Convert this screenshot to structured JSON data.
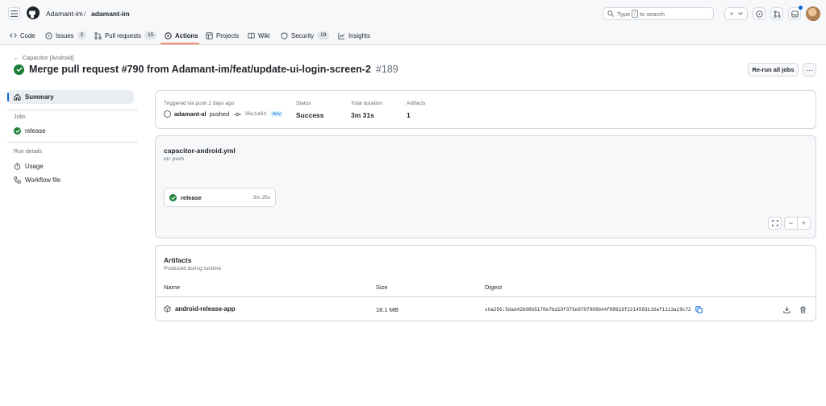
{
  "header": {
    "owner": "Adamant-im",
    "separator": "/",
    "repo": "adamant-im",
    "search_prefix": "Type",
    "search_key": "/",
    "search_suffix": "to search",
    "new_label": "+"
  },
  "nav": {
    "tabs": [
      {
        "label": "Code",
        "icon": "code-icon"
      },
      {
        "label": "Issues",
        "count": "2",
        "icon": "issue-icon"
      },
      {
        "label": "Pull requests",
        "count": "15",
        "icon": "pull-request-icon"
      },
      {
        "label": "Actions",
        "icon": "play-icon",
        "active": true
      },
      {
        "label": "Projects",
        "icon": "table-icon"
      },
      {
        "label": "Wiki",
        "icon": "book-icon"
      },
      {
        "label": "Security",
        "count": "19",
        "icon": "shield-icon"
      },
      {
        "label": "Insights",
        "icon": "graph-icon"
      }
    ]
  },
  "run": {
    "back_label": "Capacitor [Android]",
    "title": "Merge pull request #790 from Adamant-im/feat/update-ui-login-screen-2",
    "run_number": "#189",
    "rerun_label": "Re-run all jobs",
    "more_label": "···"
  },
  "sidebar": {
    "summary_label": "Summary",
    "jobs_heading": "Jobs",
    "job_label": "release",
    "run_details_heading": "Run details",
    "usage_label": "Usage",
    "workflow_file_label": "Workflow file"
  },
  "summary_card": {
    "trigger_label": "Triggered via push 2 days ago",
    "actor": "adamant-al",
    "action": "pushed",
    "commit": "36e1a61",
    "branch": "dev",
    "status_label": "Status",
    "status_value": "Success",
    "duration_label": "Total duration",
    "duration_value": "3m 31s",
    "artifacts_label": "Artifacts",
    "artifacts_value": "1"
  },
  "workflow_card": {
    "file": "capacitor-android.yml",
    "trigger": "on: push",
    "job_name": "release",
    "job_duration": "3m 25s",
    "zoom_out": "−",
    "zoom_in": "+"
  },
  "artifacts_card": {
    "title": "Artifacts",
    "subtitle": "Produced during runtime",
    "col_name": "Name",
    "col_size": "Size",
    "col_digest": "Digest",
    "rows": [
      {
        "name": "android-release-app",
        "size": "18.1 MB",
        "digest": "sha256:5dad42b08b5170e7bd19f375e9707909b44f88919f2214593110af1113a19c72"
      }
    ]
  },
  "colors": {
    "success": "#1a7f37",
    "accent": "#0969da",
    "nav_active_underline": "#fd8c73"
  }
}
